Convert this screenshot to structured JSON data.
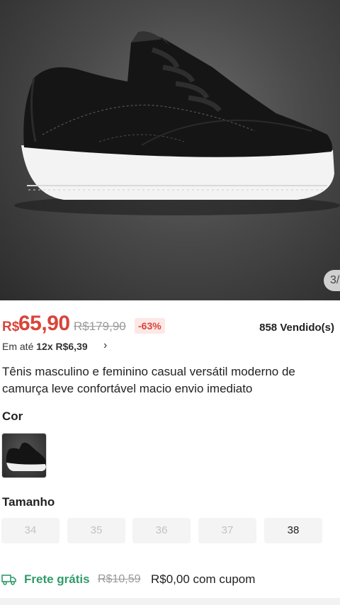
{
  "gallery": {
    "counter": "3/",
    "image_alt": "black suede sneaker with white sole"
  },
  "price": {
    "currency": "R$",
    "value": "65,90",
    "original": "R$179,90",
    "discount": "-63%",
    "sold": "858 Vendido(s)",
    "installment_prefix": "Em até ",
    "installment_value": "12x R$6,39"
  },
  "product": {
    "title": "Tênis masculino e feminino casual versátil moderno de camurça leve confortável macio envio imediato"
  },
  "color": {
    "label": "Cor"
  },
  "size": {
    "label": "Tamanho",
    "options": [
      "34",
      "35",
      "36",
      "37",
      "38"
    ],
    "available": [
      "38"
    ]
  },
  "shipping": {
    "label": "Frete grátis",
    "original": "R$10,59",
    "final": "R$0,00 com cupom"
  },
  "colors": {
    "price_red": "#d9443a",
    "shipping_green": "#2f9b6a"
  },
  "icons": {
    "installment_chevron": "chevron-right-icon",
    "shipping": "truck-icon"
  }
}
